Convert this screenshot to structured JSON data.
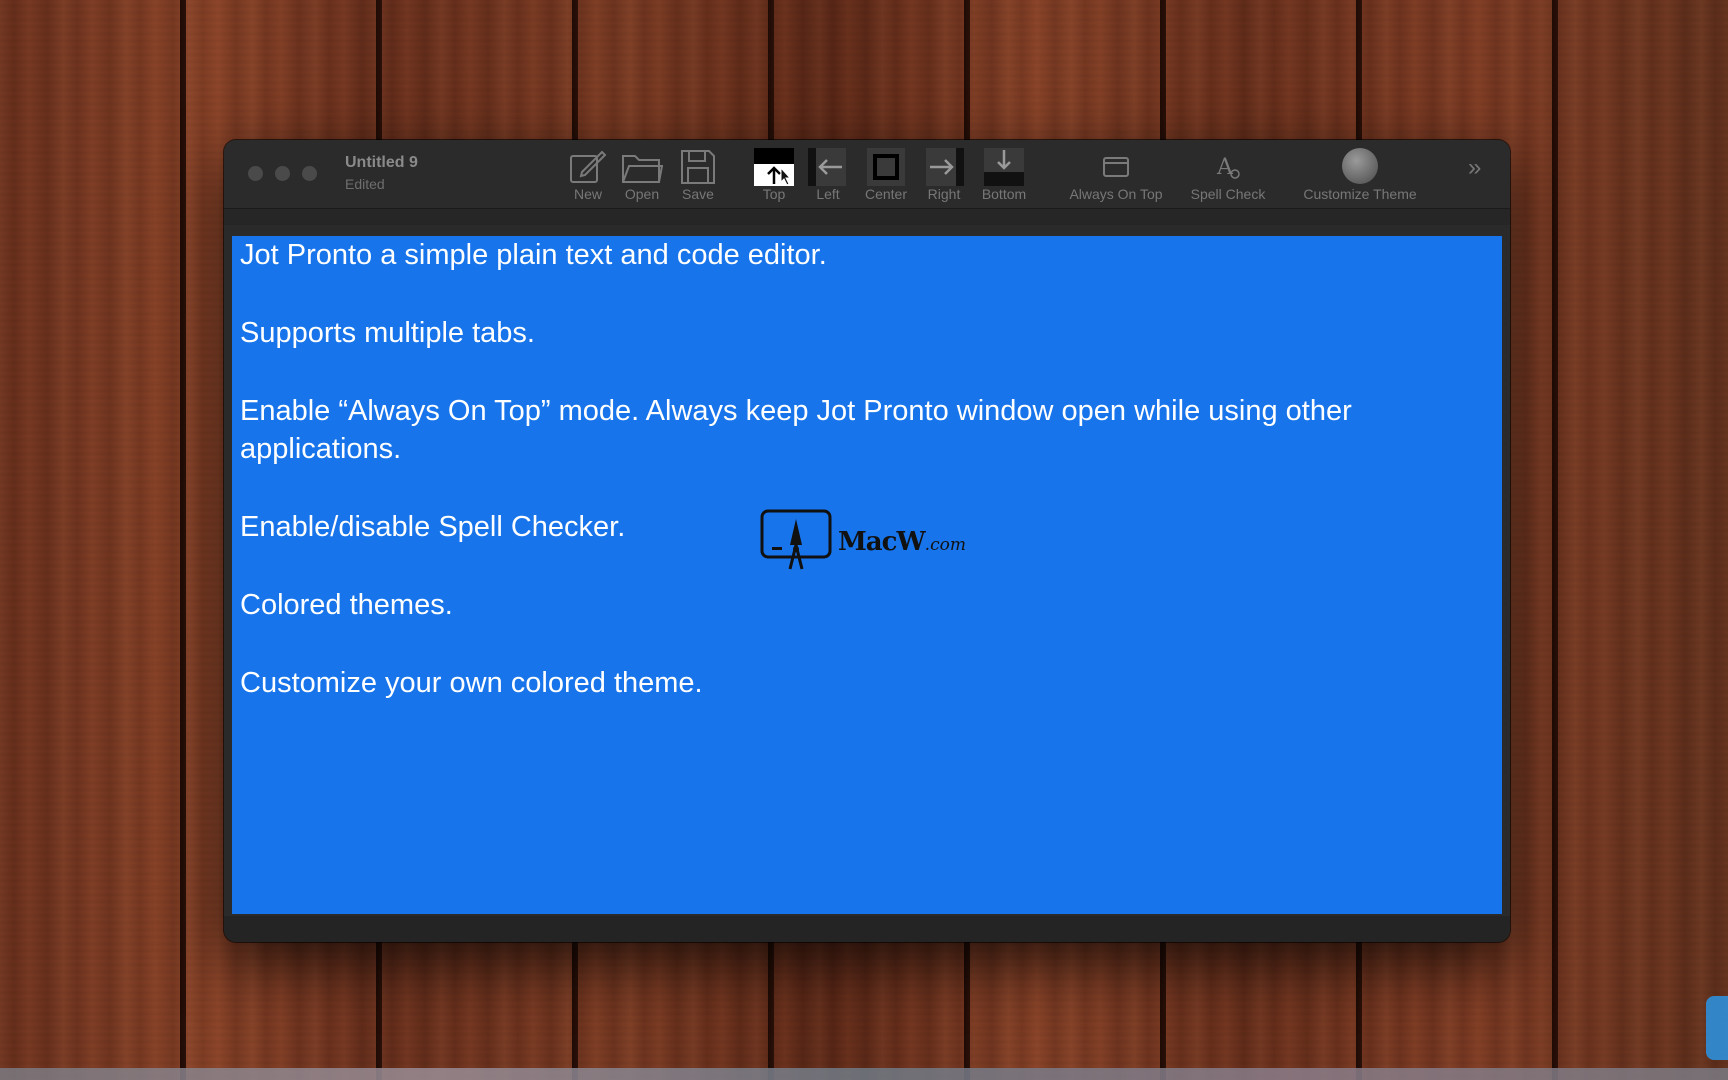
{
  "window": {
    "title": "Untitled 9",
    "subtitle": "Edited"
  },
  "toolbar": {
    "new": "New",
    "open": "Open",
    "save": "Save",
    "top": "Top",
    "left": "Left",
    "center": "Center",
    "right": "Right",
    "bottom": "Bottom",
    "always_on_top": "Always On Top",
    "spell_check": "Spell Check",
    "customize_theme": "Customize Theme",
    "more": "»"
  },
  "editor": {
    "background": "#1774eb",
    "text_color": "#ffffff",
    "lines": [
      "Jot Pronto a simple plain text and code editor.",
      "Supports multiple tabs.",
      "Enable “Always On Top” mode. Always keep Jot Pronto window open while using other",
      "applications.",
      "Enable/disable Spell Checker.",
      "Colored themes.",
      "Customize your own colored theme."
    ]
  },
  "watermark": {
    "brand": "MacW",
    "suffix": ".com"
  }
}
